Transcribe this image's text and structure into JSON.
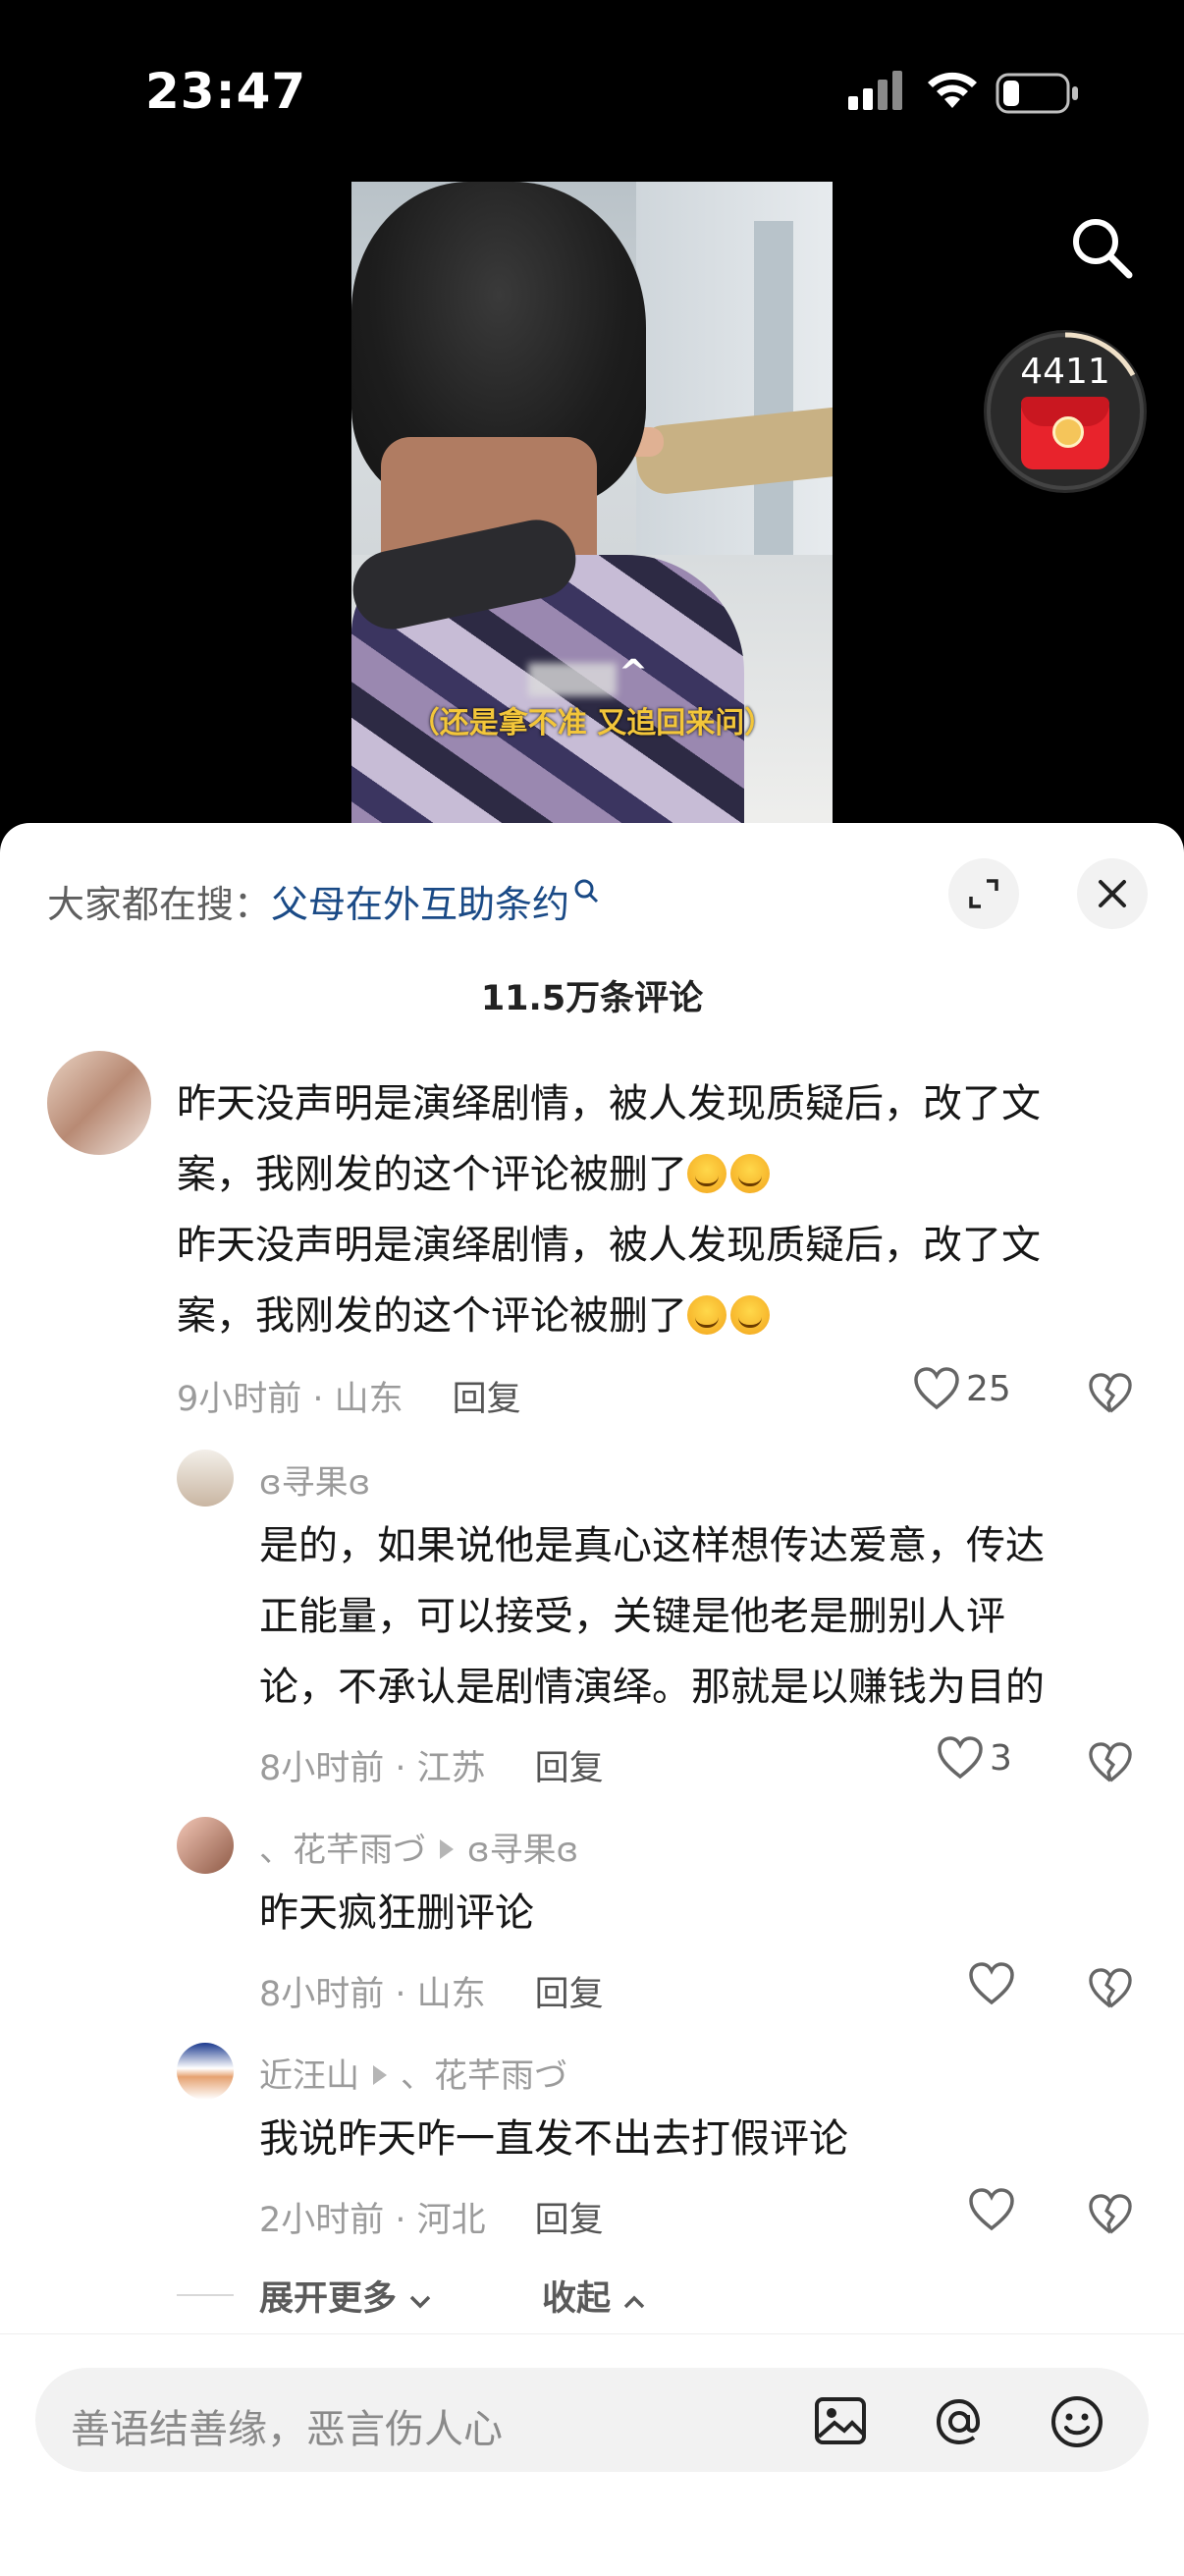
{
  "status_bar": {
    "time": "23:47"
  },
  "video": {
    "subtitle": "（还是拿不准 又追回来问）"
  },
  "reward": {
    "count": "4411"
  },
  "hot_search": {
    "prefix": "大家都在搜：",
    "query": "父母在外互助条约"
  },
  "comment_count": "11.5万条评论",
  "main_comment": {
    "lines": [
      "昨天没声明是演绎剧情，被人发现质疑后，改了文",
      "案，我刚发的这个评论被删了",
      "昨天没声明是演绎剧情，被人发现质疑后，改了文",
      "案，我刚发的这个评论被删了"
    ],
    "meta": "9小时前 · 山东",
    "reply": "回复",
    "likes": "25"
  },
  "replies": [
    {
      "user": "ɞ寻果ɞ",
      "target": "",
      "lines": [
        "是的，如果说他是真心这样想传达爱意，传达",
        "正能量，可以接受，关键是他老是删别人评",
        "论，不承认是剧情演绎。那就是以赚钱为目的"
      ],
      "meta": "8小时前 · 江苏",
      "reply": "回复",
      "likes": "3"
    },
    {
      "user": "、花芊雨づ",
      "target": "ɞ寻果ɞ",
      "lines": [
        "昨天疯狂删评论"
      ],
      "meta": "8小时前 · 山东",
      "reply": "回复",
      "likes": ""
    },
    {
      "user": "近汪山",
      "target": "、花芊雨づ",
      "lines": [
        "我说昨天咋一直发不出去打假评论"
      ],
      "meta": "2小时前 · 河北",
      "reply": "回复",
      "likes": ""
    }
  ],
  "expand_more": "展开更多",
  "collapse": "收起",
  "input": {
    "placeholder": "善语结善缘，恶言伤人心"
  },
  "colors": {
    "link": "#1a4a86",
    "reward_red": "#e8232c"
  }
}
